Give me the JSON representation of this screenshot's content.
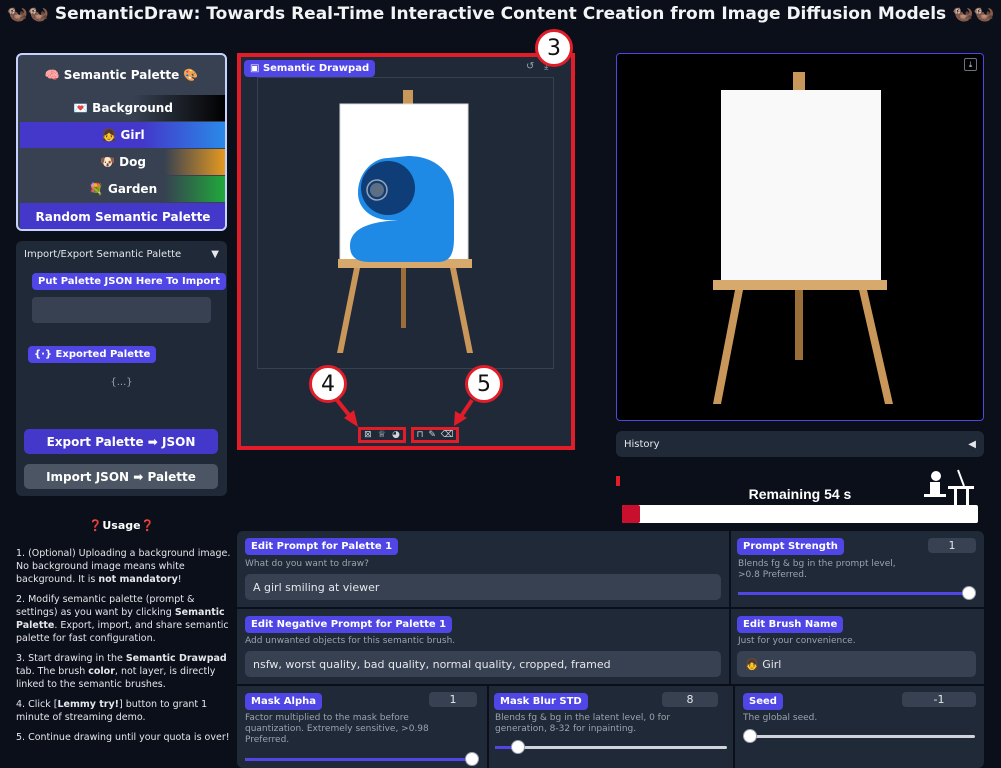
{
  "title": "SemanticDraw: Towards Real-Time Interactive Content Creation from Image Diffusion Models",
  "title_icon": "🦦🦦",
  "palette": {
    "header": "🧠 Semantic Palette 🎨",
    "items": [
      {
        "label": "💌 Background",
        "color": "#000000"
      },
      {
        "label": "👧 Girl",
        "color": "#2a8ae9"
      },
      {
        "label": "🐶 Dog",
        "color": "#e89a20"
      },
      {
        "label": "💐 Garden",
        "color": "#1faa3a"
      }
    ],
    "random_button": "Random Semantic Palette"
  },
  "import_export": {
    "header": "Import/Export Semantic Palette",
    "toggle_icon": "▼",
    "import_label": "Put Palette JSON Here To Import",
    "exported_label": "Exported Palette",
    "exported_value": "{...}",
    "export_button": "Export Palette ➡ JSON",
    "import_button": "Import JSON ➡ Palette"
  },
  "usage": {
    "title": "❓Usage❓",
    "steps": [
      {
        "a": "1. (Optional) Uploading a background image. No background image means white background. It is ",
        "b": "not mandatory",
        "c": "!"
      },
      {
        "a": "2. Modify semantic palette (prompt & settings) as you want by clicking ",
        "b": "Semantic Palette",
        "c": ". Export, import, and share semantic palette for fast configuration."
      },
      {
        "a": "3. Start drawing in the ",
        "b": "Semantic Drawpad",
        "c": " tab. The brush "
      },
      {
        "a": "4. Click [",
        "b": "Lemmy try!",
        "c": "] button to grant 1 minute of streaming demo."
      },
      {
        "a": "5. Continue drawing until your quota is over!",
        "b": "",
        "c": ""
      }
    ],
    "step3_bold2": "color",
    "step3_rest": ", not layer, is directly linked to the semantic brushes."
  },
  "drawpad": {
    "tab_label": "Semantic Drawpad",
    "callouts": [
      "3",
      "4",
      "5"
    ]
  },
  "history": {
    "label": "History",
    "toggle_icon": "◀"
  },
  "timer": {
    "remaining": "Remaining 54 s",
    "progress": 0.05
  },
  "controls": {
    "prompt_label": "Edit Prompt for Palette 1",
    "prompt_hint": "What do you want to draw?",
    "prompt_value": "A girl smiling at viewer",
    "neg_label": "Edit Negative Prompt for Palette 1",
    "neg_hint": "Add unwanted objects for this semantic brush.",
    "neg_value": "nsfw, worst quality, bad quality, normal quality, cropped, framed",
    "strength_label": "Prompt Strength",
    "strength_value": "1",
    "strength_hint": "Blends fg & bg in the prompt level, >0.8 Preferred.",
    "strength_level": 1.0,
    "brush_label": "Edit Brush Name",
    "brush_hint": "Just for your convenience.",
    "brush_value": "👧 Girl",
    "alpha_label": "Mask Alpha",
    "alpha_value": "1",
    "alpha_hint": "Factor multiplied to the mask before quantization. Extremely sensitive, >0.98 Preferred.",
    "alpha_level": 1.0,
    "blur_label": "Mask Blur STD",
    "blur_value": "8",
    "blur_hint": "Blends fg & bg in the latent level, 0 for generation, 8-32 for inpainting.",
    "blur_level": 0.1,
    "seed_label": "Seed",
    "seed_value": "-1",
    "seed_hint": "The global seed.",
    "seed_level": 0.0
  }
}
